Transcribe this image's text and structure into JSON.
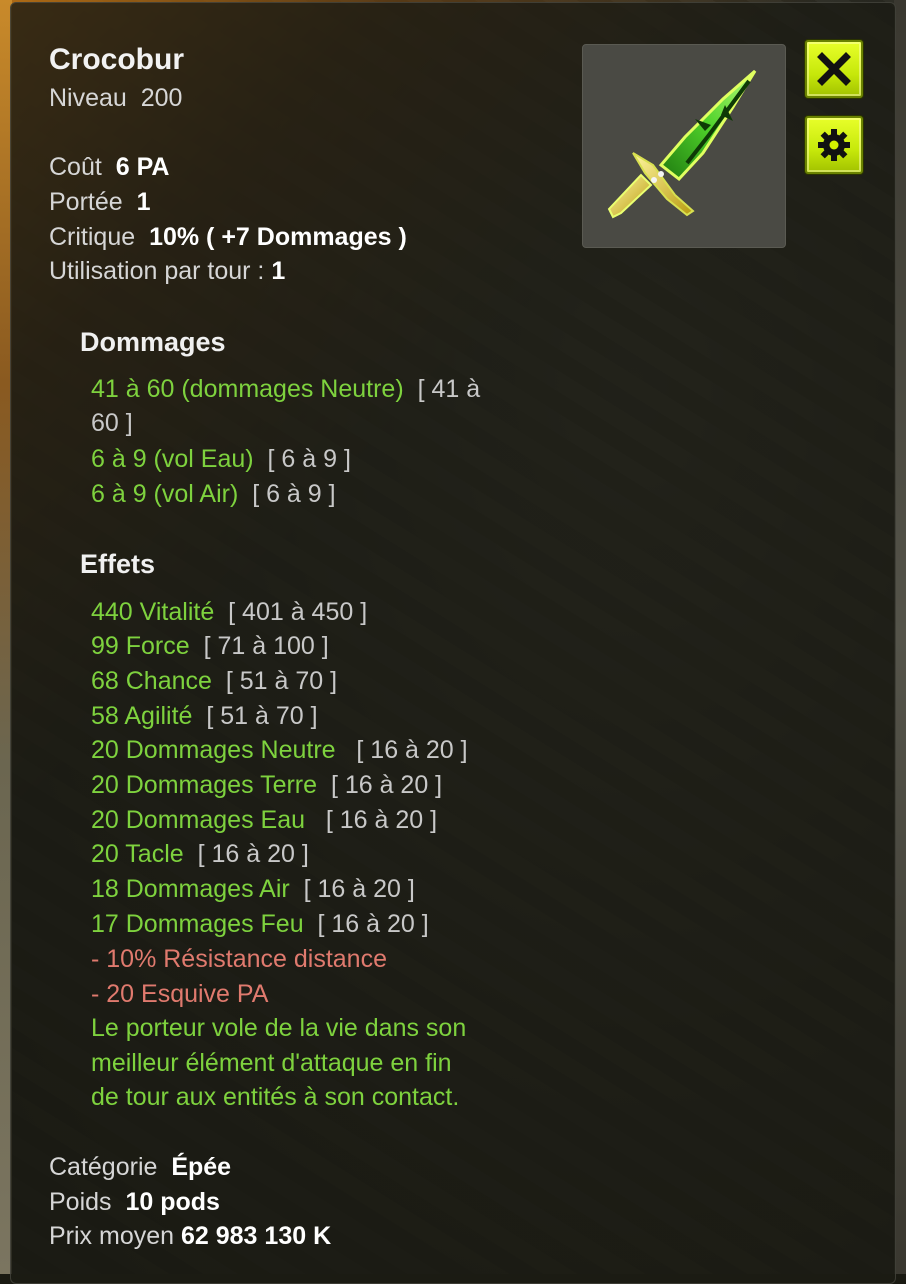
{
  "item": {
    "name": "Crocobur",
    "level_label": "Niveau",
    "level_value": "200"
  },
  "stats": {
    "cost_label": "Coût",
    "cost_value": "6 PA",
    "range_label": "Portée",
    "range_value": "1",
    "crit_label": "Critique",
    "crit_value": "10% ( +7 Dommages )",
    "uses_label": "Utilisation par tour :",
    "uses_value": "1"
  },
  "damages": {
    "title": "Dommages",
    "lines": [
      {
        "main": "41 à 60 (dommages Neutre)",
        "range": "[ 41 à",
        "range_cont": "60 ]"
      },
      {
        "main": "6 à 9 (vol Eau)",
        "range": "[ 6 à 9 ]"
      },
      {
        "main": "6 à 9 (vol Air)",
        "range": "[ 6 à 9 ]"
      }
    ]
  },
  "effects": {
    "title": "Effets",
    "lines": [
      {
        "main": "440 Vitalité",
        "range": "[ 401 à 450 ]"
      },
      {
        "main": "99 Force",
        "range": "[ 71 à 100 ]"
      },
      {
        "main": "68 Chance",
        "range": "[ 51 à 70 ]"
      },
      {
        "main": "58 Agilité",
        "range": "[ 51 à 70 ]"
      },
      {
        "main": "20 Dommages Neutre",
        "range": "[ 16 à 20 ]"
      },
      {
        "main": "20 Dommages Terre",
        "range": "[ 16 à 20 ]"
      },
      {
        "main": "20 Dommages Eau",
        "range": "[ 16 à 20 ]"
      },
      {
        "main": "20 Tacle",
        "range": "[ 16 à 20 ]"
      },
      {
        "main": "18 Dommages Air",
        "range": "[ 16 à 20 ]"
      },
      {
        "main": "17 Dommages Feu",
        "range": "[ 16 à 20 ]"
      }
    ],
    "negatives": [
      "- 10% Résistance distance",
      "- 20 Esquive PA"
    ],
    "special": [
      "Le porteur vole de la vie dans son",
      "meilleur élément d'attaque en fin",
      "de tour aux entités à son contact."
    ]
  },
  "footer": {
    "category_label": "Catégorie",
    "category_value": "Épée",
    "weight_label": "Poids",
    "weight_value": "10 pods",
    "price_label": "Prix moyen",
    "price_value": "62 983 130 K"
  },
  "colors": {
    "positive": "#7ed23e",
    "negative": "#e07a6e",
    "button": "#d4f000"
  },
  "icons": {
    "close": "close-icon",
    "settings": "gear-icon",
    "item": "green-sword-icon"
  }
}
